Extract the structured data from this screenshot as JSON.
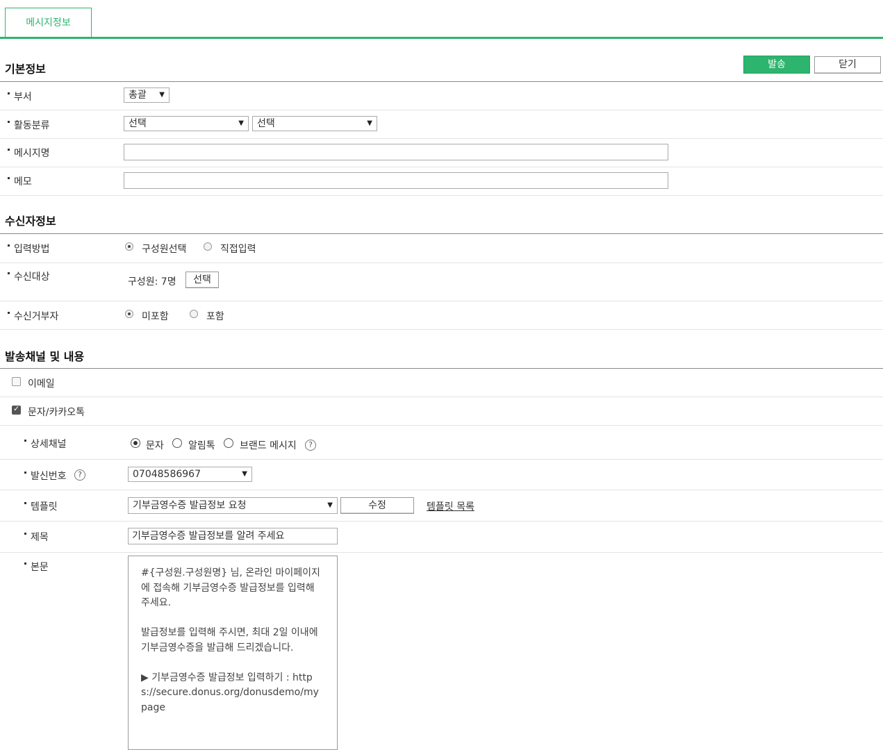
{
  "tabs": {
    "active": "메시지정보"
  },
  "actions": {
    "send": "발송",
    "close": "닫기"
  },
  "basic": {
    "title": "기본정보",
    "dept_label": "부서",
    "dept_value": "총괄",
    "category_label": "활동분류",
    "category1": "선택",
    "category2": "선택",
    "message_name_label": "메시지명",
    "memo_label": "메모"
  },
  "recipient": {
    "title": "수신자정보",
    "input_method_label": "입력방법",
    "input_method_options": [
      "구성원선택",
      "직접입력"
    ],
    "target_label": "수신대상",
    "target_value": "구성원: 7명",
    "target_select": "선택",
    "reject_label": "수신거부자",
    "reject_options": [
      "미포함",
      "포함"
    ]
  },
  "channel": {
    "title": "발송채널 및 내용",
    "email_label": "이메일",
    "sms_label": "문자/카카오톡",
    "detail_label": "상세채널",
    "detail_options": [
      "문자",
      "알림톡",
      "브랜드 메시지"
    ],
    "sender_label": "발신번호",
    "sender_value": "07048586967",
    "template_label": "템플릿",
    "template_value": "기부금영수증 발급정보 요청",
    "template_edit": "수정",
    "template_list": "템플릿 목록",
    "subject_label": "제목",
    "subject_value": "기부금영수증 발급정보를 알려 주세요",
    "body_label": "본문",
    "body_value": "#{구성원.구성원명} 님, 온라인 마이페이지에 접속해 기부금영수증 발급정보를 입력해 주세요.\n\n발급정보를 입력해 주시면, 최대 2일 이내에 기부금영수증을 발급해 드리겠습니다.\n\n▶ 기부금영수증 발급정보 입력하기 : https://secure.donus.org/donusdemo/mypage"
  }
}
